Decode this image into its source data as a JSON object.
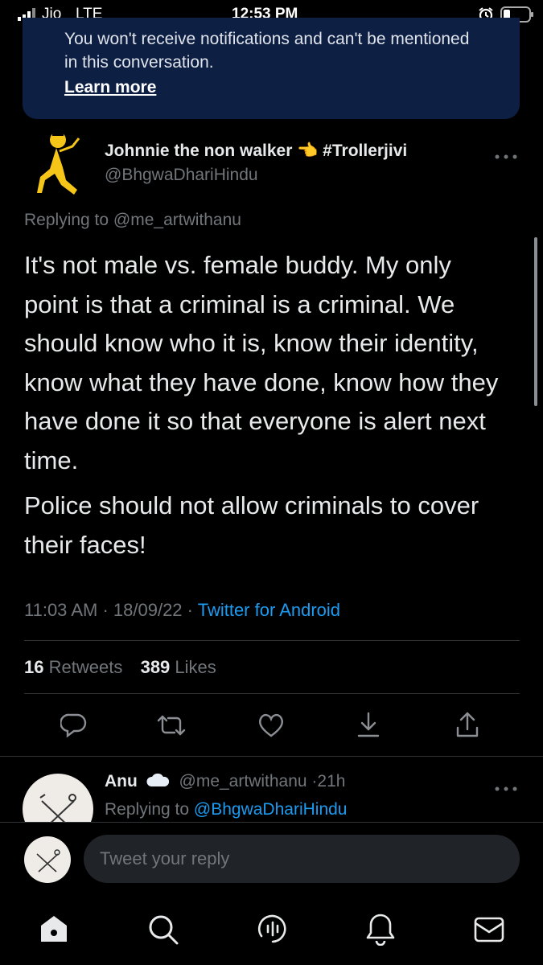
{
  "status_bar": {
    "carrier": "Jio",
    "network": "LTE",
    "time": "12:53 PM"
  },
  "banner": {
    "text": "You won't receive notifications and can't be mentioned in this conversation.",
    "link": "Learn more"
  },
  "tweet": {
    "author_name": "Johnnie the non walker 👈 #Trollerjivi",
    "author_handle": "@BhgwaDhariHindu",
    "replying_prefix": "Replying to",
    "replying_to": "@me_artwithanu",
    "paragraph1": "It's not male vs. female buddy. My only point is that a criminal is a criminal. We should know who it is, know their identity, know what they have done, know how they have done it so that everyone is alert next time.",
    "paragraph2": "Police should not allow criminals to cover their faces!",
    "time": "11:03 AM",
    "date": "18/09/22",
    "source": "Twitter for Android",
    "retweets_count": "16",
    "retweets_label": "Retweets",
    "likes_count": "389",
    "likes_label": "Likes"
  },
  "reply": {
    "author_name": "Anu",
    "author_handle": "@me_artwithanu",
    "age": "21h",
    "replying_prefix": "Replying to",
    "replying_to": "@BhgwaDhariHindu"
  },
  "composer": {
    "placeholder": "Tweet your reply"
  },
  "icons": {
    "tweet_actions": [
      "reply-icon",
      "retweet-icon",
      "like-icon",
      "bookmark-icon",
      "share-icon"
    ],
    "bottom_nav": [
      "home-icon",
      "search-icon",
      "spaces-icon",
      "notifications-icon",
      "messages-icon"
    ]
  },
  "colors": {
    "background": "#000000",
    "banner": "#0e1f44",
    "link_blue": "#1d9bf0",
    "muted": "#71767b",
    "composer_field": "#202327"
  }
}
